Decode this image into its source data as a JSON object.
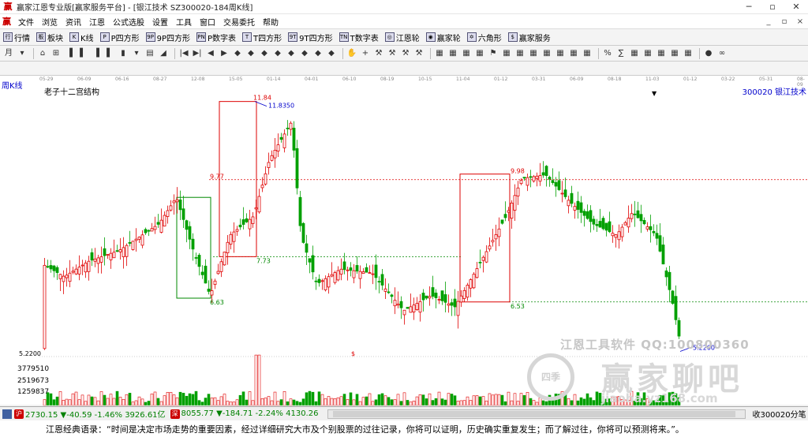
{
  "window": {
    "title": "赢家江恩专业版[赢家服务平台] - [银江技术  SZ300020-184周K线]",
    "minimize": "─",
    "restore": "▫",
    "close": "✕"
  },
  "menu": {
    "logo": "赢",
    "items": [
      "文件",
      "浏览",
      "资讯",
      "江恩",
      "公式选股",
      "设置",
      "工具",
      "窗口",
      "交易委托",
      "帮助"
    ],
    "right": [
      "_",
      "▫",
      "×"
    ]
  },
  "toolbar1": [
    {
      "icon": "行",
      "label": "行情"
    },
    {
      "icon": "板",
      "label": "板块"
    },
    {
      "icon": "K",
      "label": "K线"
    },
    {
      "icon": "P",
      "label": "P四方形"
    },
    {
      "icon": "9P",
      "label": "9P四方形"
    },
    {
      "icon": "PN",
      "label": "P数字表"
    },
    {
      "icon": "T",
      "label": "T四方形"
    },
    {
      "icon": "9T",
      "label": "9T四方形"
    },
    {
      "icon": "TN",
      "label": "T数字表"
    },
    {
      "icon": "◎",
      "label": "江恩轮"
    },
    {
      "icon": "◉",
      "label": "赢家轮"
    },
    {
      "icon": "✡",
      "label": "六角形"
    },
    {
      "icon": "$",
      "label": "赢家服务"
    }
  ],
  "toolbar2_icons": [
    "月",
    "▾",
    "⌂",
    "⊞",
    "▐",
    "▌",
    "▐",
    "▌",
    "▮",
    "▾",
    "▤",
    "◢",
    "|◀",
    "▶|",
    "◀",
    "▶",
    "◆",
    "◆",
    "◆",
    "◆",
    "◆",
    "◆",
    "◆",
    "◆",
    "✋",
    "+",
    "⚒",
    "⚒",
    "⚒",
    "⚒",
    "▦",
    "▦",
    "▦",
    "▦",
    "⚑",
    "▦",
    "▦",
    "▦",
    "▦",
    "▦",
    "▦",
    "▦",
    "%",
    "∑",
    "▦",
    "▦",
    "▦",
    "▦",
    "▦",
    "●",
    "∞"
  ],
  "chart": {
    "period_label": "周K线",
    "structure_label": "老子十二宫结构",
    "stock": "300020  银江技术",
    "dates": [
      "05-29",
      "06-09",
      "06-16",
      "08-27",
      "12-08",
      "15-05",
      "01-14",
      "04-01",
      "06-10",
      "08-19",
      "10-15",
      "11-04",
      "01-12",
      "03-31",
      "06-09",
      "08-18",
      "11-03",
      "01-12",
      "03-22",
      "05-31",
      "08-09"
    ],
    "price_labels": {
      "high": "11.84",
      "high_marker": "11.8350",
      "p977": "9.77",
      "p998": "9.98",
      "p773": "7.73",
      "p663": "6.63",
      "p653": "6.53",
      "low_marker": "5.2200",
      "axis_low": "5.2200",
      "dollar": "$"
    },
    "volume_labels": [
      "3779510",
      "2519673",
      "1259837"
    ]
  },
  "watermark": {
    "line1": "江恩工具软件  QQ:100800360",
    "logo": "四季",
    "big": "赢家聊吧",
    "url": "jiaoba.yz168.com"
  },
  "statusbar": {
    "index1": {
      "badge": "沪",
      "text": "2730.15 ▼-40.59 -1.46% 3926.61亿"
    },
    "index2": {
      "badge": "深",
      "text": "8055.77 ▼-184.71 -2.24% 4130.26"
    },
    "right": "收300020分笔"
  },
  "quote": "江恩经典语录：“时间是决定市场走势的重要因素，经过详细研究大市及个别股票的过往记录，你将可以证明，历史确实重复发生；而了解过往，你将可以预测将来。”。",
  "colors": {
    "up": "#e00000",
    "down": "#00a000",
    "box_red": "#e00000",
    "box_green": "#008000"
  }
}
